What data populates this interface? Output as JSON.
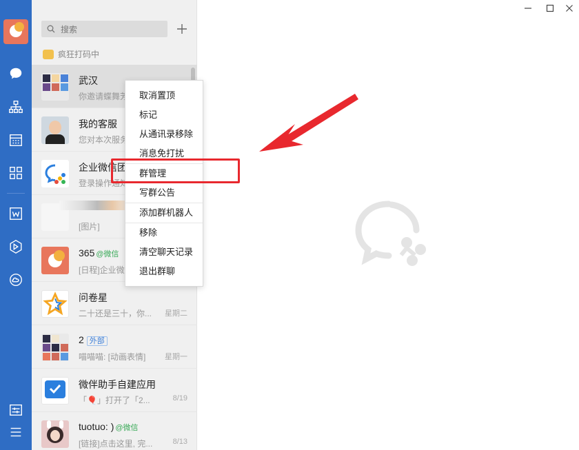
{
  "search": {
    "placeholder": "搜索"
  },
  "status_text": "疯狂打码中",
  "chats": [
    {
      "name": "武汉",
      "snippet": "你邀请蝶舞芳",
      "time": ""
    },
    {
      "name": "我的客服",
      "snippet": "您对本次服务",
      "time": ""
    },
    {
      "name": "企业微信团队",
      "snippet": "登录操作通知",
      "time": ""
    },
    {
      "name": "",
      "snippet": "[图片]",
      "time": ""
    },
    {
      "name": "365",
      "tag": "@微信",
      "snippet": "[日程]企业微",
      "time": ""
    },
    {
      "name": "问卷星",
      "snippet": "二十还是三十，你...",
      "time": "星期二"
    },
    {
      "name": "2",
      "tag": "外部",
      "snippet": "喵喵喵: [动画表情]",
      "time": "星期一"
    },
    {
      "name": "微伴助手自建应用",
      "snippet": "「🎈」打开了「2...",
      "time": "8/19"
    },
    {
      "name": "tuotuo: )",
      "tag": "@微信",
      "snippet": "[链接]点击这里, 完...",
      "time": "8/13"
    }
  ],
  "context_menu": [
    "取消置顶",
    "标记",
    "从通讯录移除",
    "消息免打扰",
    "群管理",
    "写群公告",
    "添加群机器人",
    "移除",
    "清空聊天记录",
    "退出群聊"
  ],
  "colors": {
    "rail": "#2f6dc4",
    "highlight": "#e8282e",
    "panel": "#f0f0f0"
  }
}
